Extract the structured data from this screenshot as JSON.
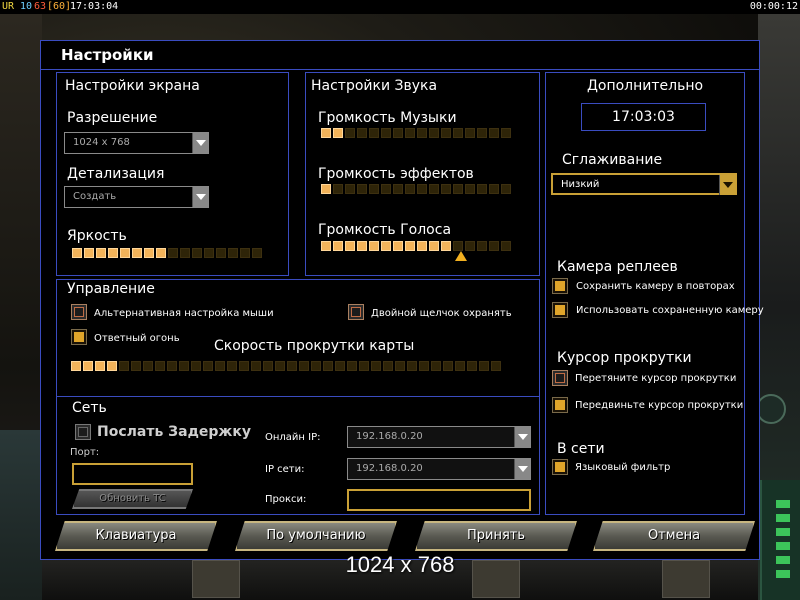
{
  "topbar": {
    "ur": "UR",
    "n10": "10",
    "n63": "63",
    "b60": "[60]",
    "clock": "17:03:04",
    "timer": "00:00:12"
  },
  "dialog": {
    "title": "Настройки"
  },
  "screen": {
    "title": "Настройки экрана",
    "resolution_label": "Разрешение",
    "resolution_value": "1024 x 768",
    "detail_label": "Детализация",
    "detail_value": "Создать",
    "brightness_label": "Яркость",
    "brightness_level": 0.5
  },
  "sound": {
    "title": "Настройки Звука",
    "music_label": "Громкость Музыки",
    "music_level": 0.15,
    "effects_label": "Громкость эффектов",
    "effects_level": 0.05,
    "voice_label": "Громкость Голоса",
    "voice_level": 0.7
  },
  "extra": {
    "title": "Дополнительно",
    "time": "17:03:03",
    "aa_label": "Сглаживание",
    "aa_value": "Низкий",
    "replay_cam_title": "Камера реплеев",
    "replay_opt1": "Сохранить камеру в повторах",
    "replay_opt2": "Использовать сохраненную камеру",
    "scroll_title": "Курсор прокрутки",
    "scroll_opt1": "Перетяните курсор прокрутки",
    "scroll_opt2": "Передвиньте курсор прокрутки",
    "online_title": "В сети",
    "lang_filter": "Языковый фильтр"
  },
  "controls": {
    "title": "Управление",
    "alt_mouse": "Альтернативная настройка мыши",
    "double_click": "Двойной щелчок охранять",
    "return_fire": "Ответный огонь",
    "scroll_speed_label": "Скорость прокрутки карты",
    "scroll_speed_level": 0.1
  },
  "network": {
    "title": "Сеть",
    "send_delay": "Послать Задержку",
    "port_label": "Порт:",
    "update_button": "Обновить TC",
    "online_ip_label": "Онлайн IP:",
    "online_ip": "192.168.0.20",
    "lan_ip_label": "IP сети:",
    "lan_ip": "192.168.0.20",
    "proxy_label": "Прокси:"
  },
  "buttons": {
    "keyboard": "Клавиатура",
    "defaults": "По умолчанию",
    "accept": "Принять",
    "cancel": "Отмена"
  },
  "footer_caption": "1024 x 768",
  "colors": {
    "border": "#3a4cc0",
    "slider_on": "#f2b35a",
    "gold": "#c9a036"
  }
}
